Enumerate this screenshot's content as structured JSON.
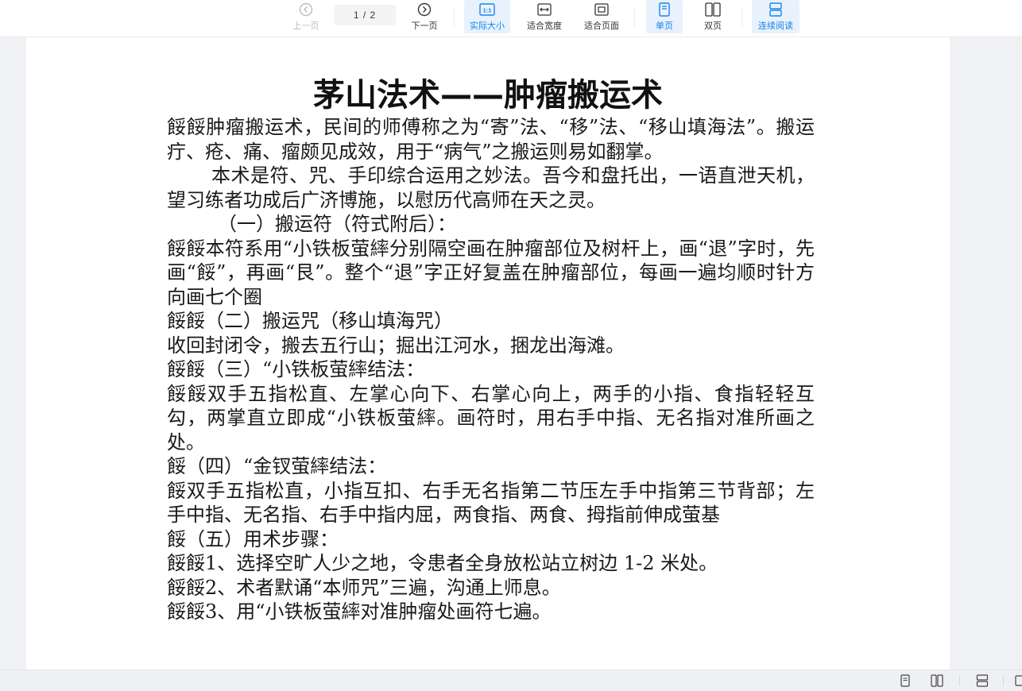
{
  "toolbar": {
    "prev_label": "上一页",
    "page_indicator": "1 / 2",
    "next_label": "下一页",
    "actual_size_label": "实际大小",
    "actual_size_icon_text": "1:1",
    "fit_width_label": "适合宽度",
    "fit_page_label": "适合页面",
    "single_page_label": "单页",
    "double_page_label": "双页",
    "continuous_label": "连续阅读"
  },
  "document": {
    "title": "茅山法术——肿瘤搬运术",
    "paragraphs": [
      "餒餒肿瘤搬运术，民间的师傅称之为“寄”法、“移”法、“移山填海法”。搬运疔、疮、痛、瘤颇见成效，用于“病气”之搬运则易如翻掌。",
      "本术是符、咒、手印综合运用之妙法。吾今和盘托出，一语直泄天机，望习练者功成后广济博施，以慰历代高师在天之灵。",
      "（一）搬运符（符式附后）：",
      "餒餒本符系用“小铁板萤繂分别隔空画在肿瘤部位及树杆上，画“退”字时，先画“餒”，再画“艮”。整个“退”字正好复盖在肿瘤部位，每画一遍均顺时针方向画七个圈",
      "餒餒（二）搬运咒（移山填海咒）",
      "收回封闭令，搬去五行山；掘出江河水，捆龙出海滩。",
      "餒餒（三）“小铁板萤繂结法：",
      "餒餒双手五指松直、左掌心向下、右掌心向上，两手的小指、食指轻轻互勾，两掌直立即成“小铁板萤繂。画符时，用右手中指、无名指对准所画之处。",
      "餒（四）“金钗萤繂结法：",
      "餒双手五指松直，小指互扣、右手无名指第二节压左手中指第三节背部；左手中指、无名指、右手中指内屈，两食指、两食、拇指前伸成萤基",
      "餒（五）用术步骤：",
      "餒餒1、选择空旷人少之地，令患者全身放松站立树边 1-2 米处。",
      "餒餒2、术者默诵“本师咒”三遍，沟通上师息。",
      "餒餒3、用“小铁板萤繂对准肿瘤处画符七遍。"
    ]
  },
  "colors": {
    "accent": "#1a84e6",
    "active_bg": "#e7f2fd",
    "disabled": "#b9bcc2",
    "viewer_bg": "#f0f1f4"
  }
}
